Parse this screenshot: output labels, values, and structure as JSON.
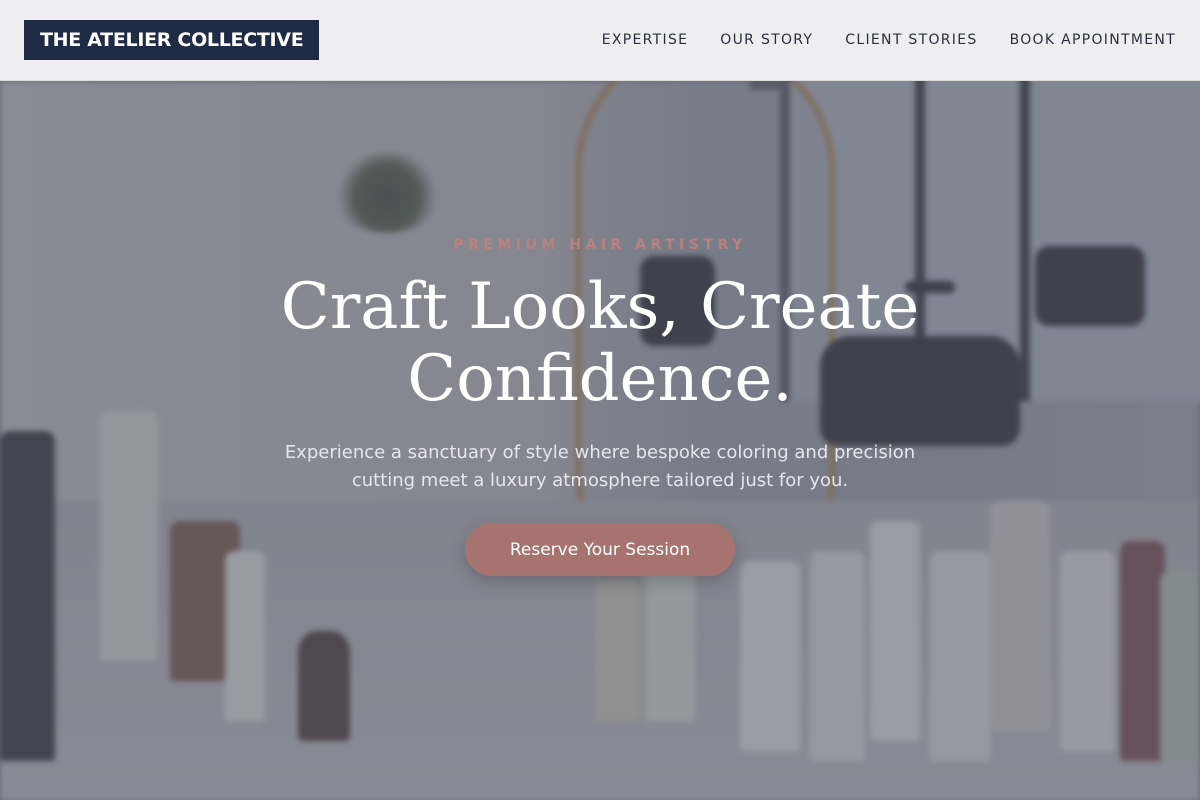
{
  "header": {
    "logo_text": "THE ATELIER COLLECTIVE",
    "nav": [
      {
        "label": "EXPERTISE"
      },
      {
        "label": "OUR STORY"
      },
      {
        "label": "CLIENT STORIES"
      },
      {
        "label": "BOOK APPOINTMENT"
      }
    ]
  },
  "hero": {
    "eyebrow": "PREMIUM HAIR ARTISTRY",
    "headline_line1": "Craft Looks, Create",
    "headline_line2": "Confidence.",
    "subhead": "Experience a sanctuary of style where bespoke coloring and precision cutting meet a luxury atmosphere tailored just for you.",
    "cta_label": "Reserve Your Session"
  },
  "colors": {
    "logo_bg": "#1f2a44",
    "accent": "#a67371",
    "eyebrow": "#b8827f",
    "header_bg": "#f4f4f5"
  }
}
